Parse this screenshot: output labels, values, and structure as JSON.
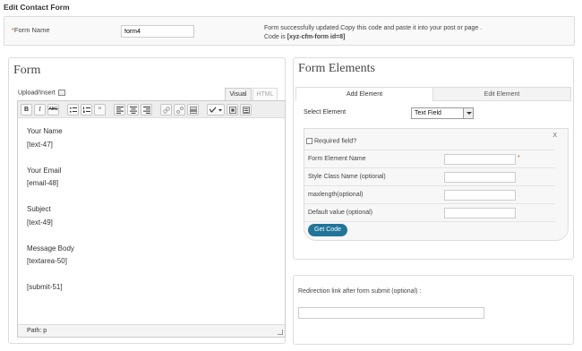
{
  "page": {
    "title": "Edit Contact Form"
  },
  "top": {
    "form_name_label": "Form Name",
    "form_name_value": "form4",
    "success_message": "Form successfully updated.Copy this code and paste it into your post or page .",
    "code_prefix": "Code is",
    "code_value": "[xyz-cfm-form id=8]"
  },
  "form_panel": {
    "title": "Form",
    "upload_insert": "Upload/Insert",
    "tab_visual": "Visual",
    "tab_html": "HTML",
    "toolbar": {
      "bold": "B",
      "italic": "I",
      "strike": "ABC",
      "quote": "“"
    },
    "content": [
      "Your Name",
      "[text-47]",
      "",
      "Your Email",
      "[email-48]",
      "",
      "Subject",
      "[text-49]",
      "",
      "Message Body",
      "[textarea-50]",
      "",
      "[submit-51]"
    ],
    "path_label": "Path: p"
  },
  "elements_panel": {
    "title": "Form Elements",
    "tab_add": "Add Element",
    "tab_edit": "Edit Element",
    "select_label": "Select Element",
    "select_value": "Text Field",
    "close_label": "X",
    "required_label": "Required field?",
    "rows": [
      {
        "label": "Form Element Name",
        "required": true
      },
      {
        "label": "Style Class Name (optional)",
        "required": false
      },
      {
        "label": "maxlength(optional)",
        "required": false
      },
      {
        "label": "Default value (optional)",
        "required": false
      }
    ],
    "get_code_label": "Get Code"
  },
  "redirect": {
    "label": "Redirection link after form submit (optional) :",
    "value": ""
  },
  "colors": {
    "button_blue": "#21759b",
    "required_star": "#d54e21"
  }
}
